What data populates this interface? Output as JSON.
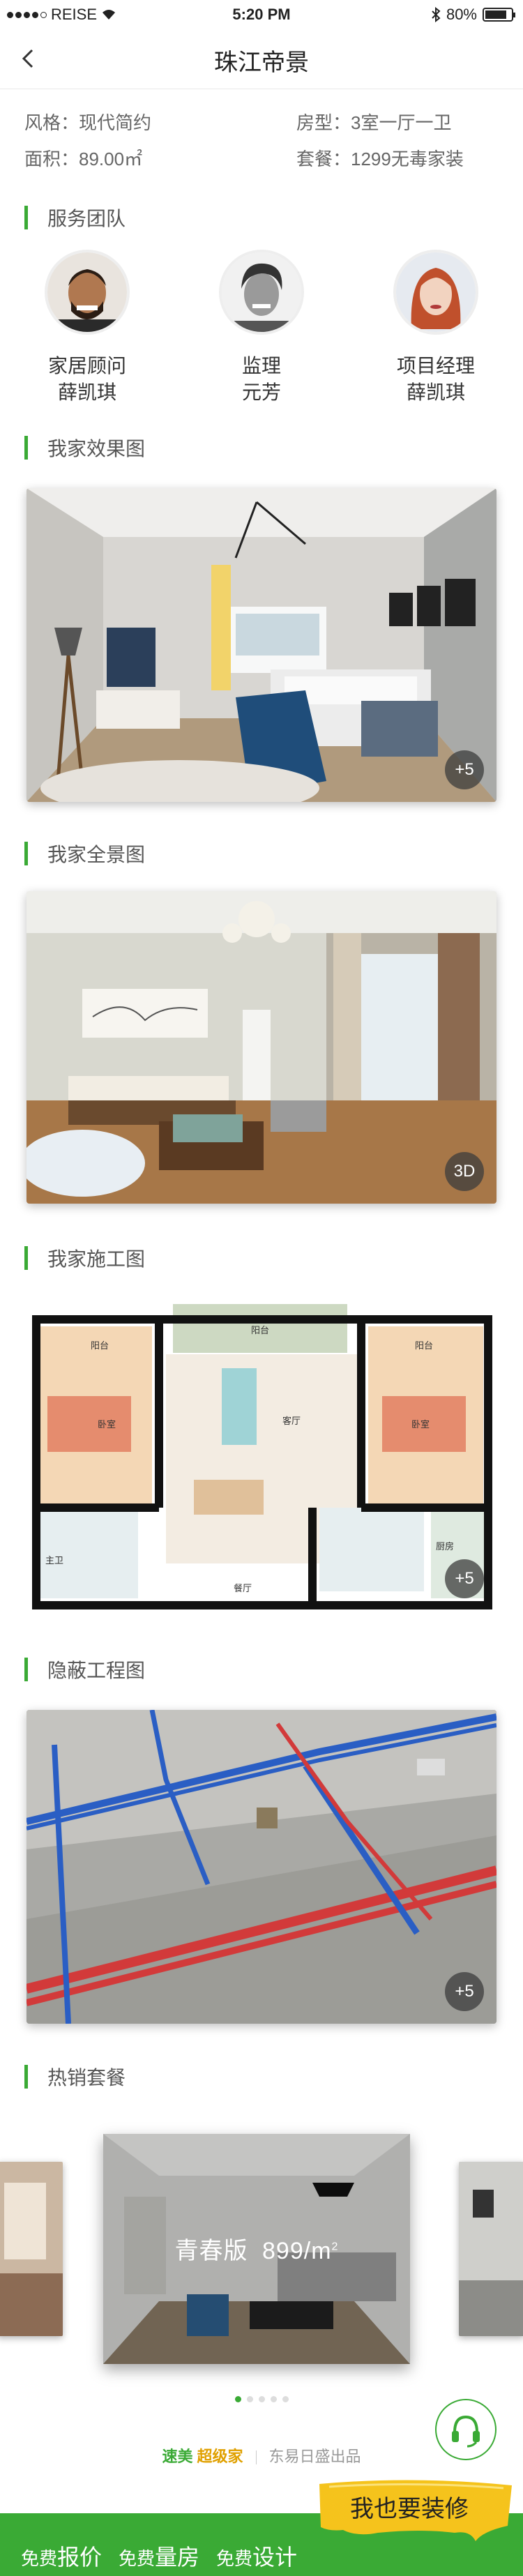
{
  "status_bar": {
    "carrier": "REISE",
    "time": "5:20 PM",
    "battery": "80%"
  },
  "nav": {
    "title": "珠江帝景"
  },
  "info": {
    "style": "风格：现代简约",
    "room_type": "房型：3室一厅一卫",
    "area": "面积：89.00㎡",
    "package": "套餐：1299无毒家装"
  },
  "sections": {
    "team": "服务团队",
    "render": "我家效果图",
    "panorama": "我家全景图",
    "construction": "我家施工图",
    "hidden": "隐蔽工程图",
    "hot": "热销套餐"
  },
  "team": [
    {
      "role": "家居顾问",
      "name": "薛凯琪"
    },
    {
      "role": "监理",
      "name": "元芳"
    },
    {
      "role": "项目经理",
      "name": "薛凯琪"
    }
  ],
  "badges": {
    "render": "+5",
    "panorama": "3D",
    "construction": "+5",
    "hidden": "+5"
  },
  "floorplan_labels": {
    "balcony_top": "阳台",
    "balcony_left": "阳台",
    "balcony_right": "阳台",
    "bedroom_left": "卧室",
    "bedroom_right": "卧室",
    "living": "客厅",
    "dining": "餐厅",
    "bath": "主卫",
    "kitchen": "厨房"
  },
  "carousel": {
    "caption_name": "青春版",
    "caption_price": "899/m",
    "caption_sup": "2",
    "active_index": 0,
    "count": 5
  },
  "brand": {
    "name1": "速美",
    "name2": "超级家",
    "maker": "东易日盛出品"
  },
  "bottom": {
    "item1_a": "免费",
    "item1_b": "报价",
    "item2_a": "免费",
    "item2_b": "量房",
    "item3_a": "免费",
    "item3_b": "设计",
    "cta": "我也要装修"
  },
  "colors": {
    "accent": "#3aaa35",
    "cta_yellow": "#f5c31c"
  }
}
